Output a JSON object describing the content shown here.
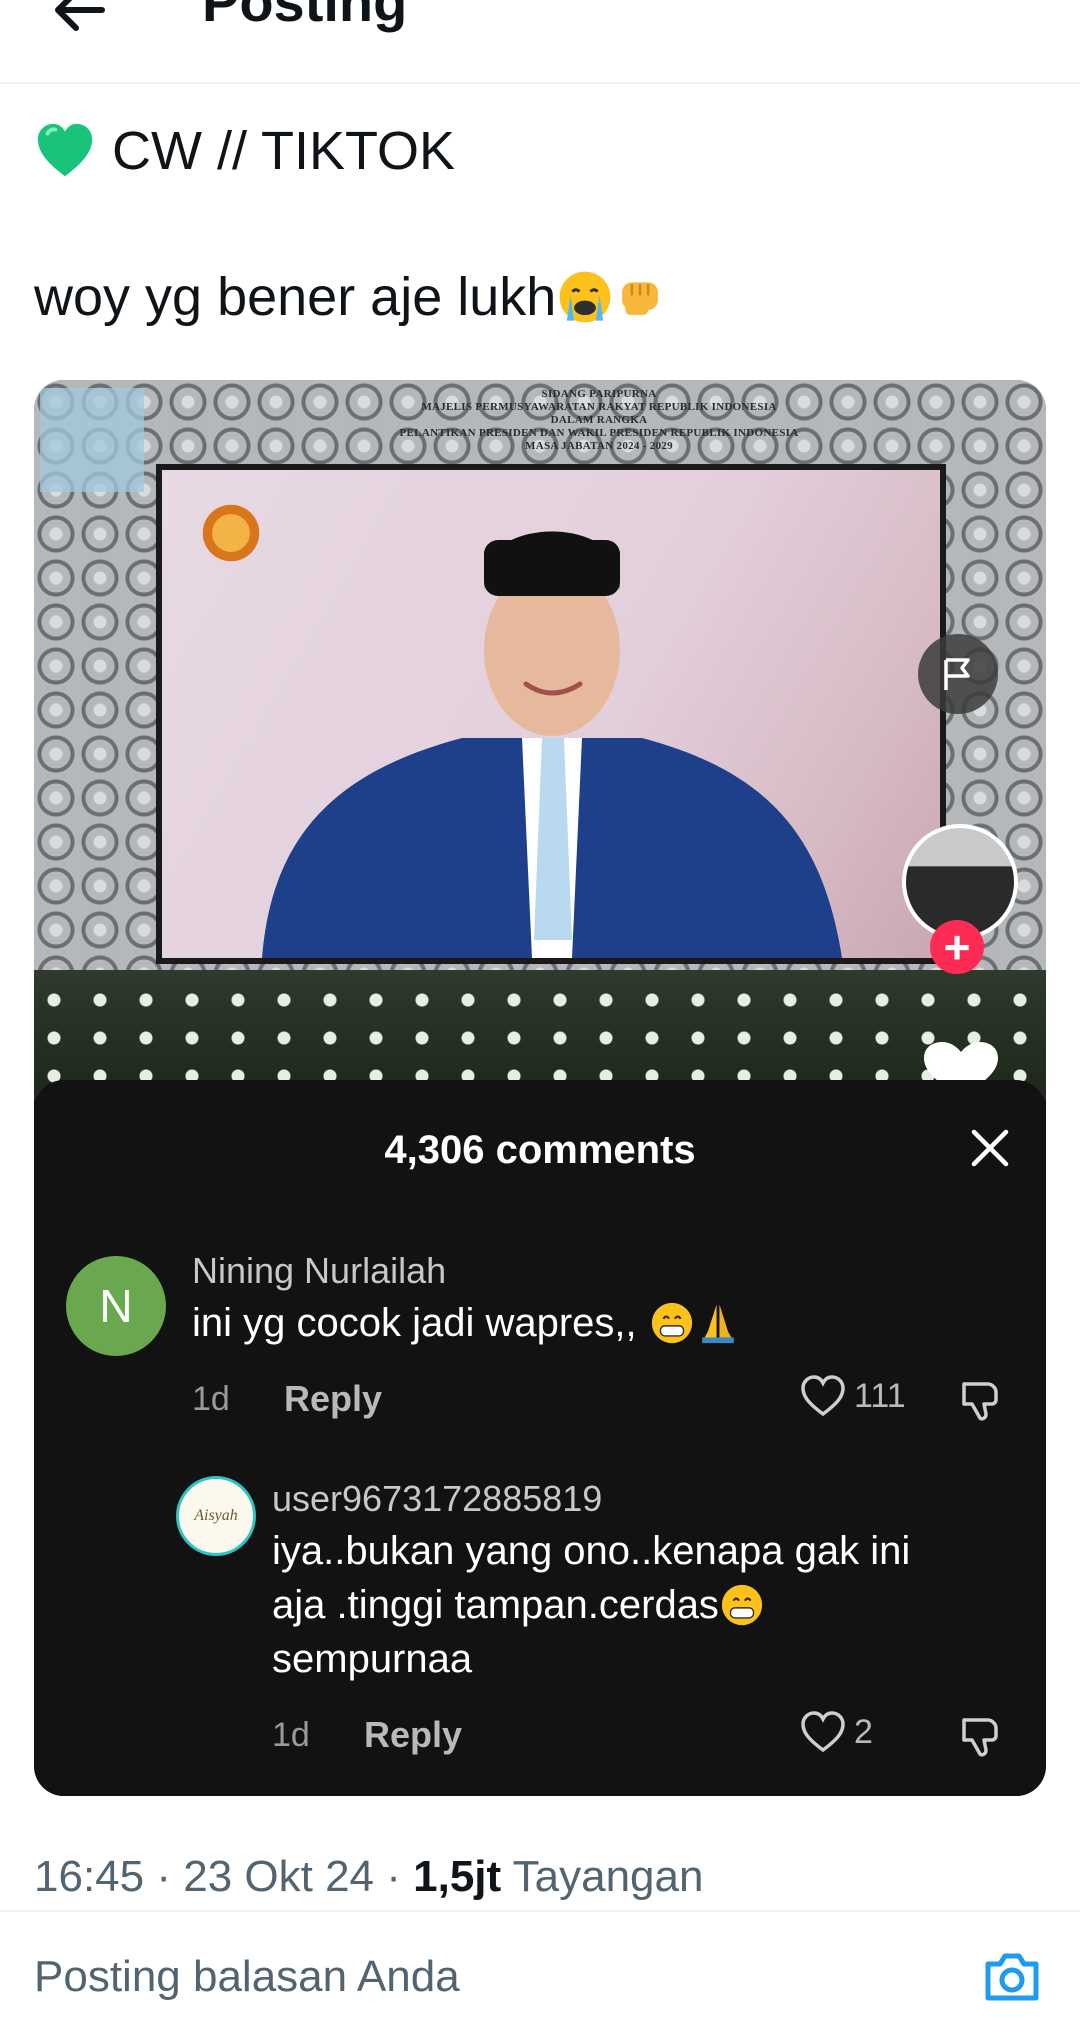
{
  "header": {
    "title": "Posting"
  },
  "post": {
    "line1_text": "CW // TIKTOK",
    "line2_text": "woy yg bener aje lukh"
  },
  "video": {
    "banner_lines": [
      "SIDANG PARIPURNA",
      "MAJELIS PERMUSYAWARATAN RAKYAT REPUBLIK INDONESIA",
      "DALAM RANGKA",
      "PELANTIKAN PRESIDEN DAN WAKIL PRESIDEN REPUBLIK INDONESIA",
      "MASA JABATAN 2024 - 2029"
    ]
  },
  "comments_sheet": {
    "count_label": "4,306 comments",
    "comments": [
      {
        "avatar_letter": "N",
        "name": "Nining Nurlailah",
        "text": "ini yg cocok jadi wapres,,",
        "age": "1d",
        "reply_label": "Reply",
        "likes": "111"
      },
      {
        "avatar_text": "Aisyah",
        "name": "user9673172885819",
        "text_lines": [
          "iya..bukan yang ono..kenapa gak ini",
          "aja .tinggi tampan.cerdas",
          "sempurnaa"
        ],
        "age": "1d",
        "reply_label": "Reply",
        "likes": "2"
      }
    ]
  },
  "post_meta": {
    "time": "16:45",
    "date": "23 Okt 24",
    "views_count": "1,5jt",
    "views_label": "Tayangan"
  },
  "reply_bar": {
    "placeholder": "Posting balasan Anda"
  },
  "colors": {
    "accent": "#1d9bf0",
    "tiktok_red": "#fe2c55",
    "sheet_bg": "#121212",
    "muted_text": "#536471"
  }
}
